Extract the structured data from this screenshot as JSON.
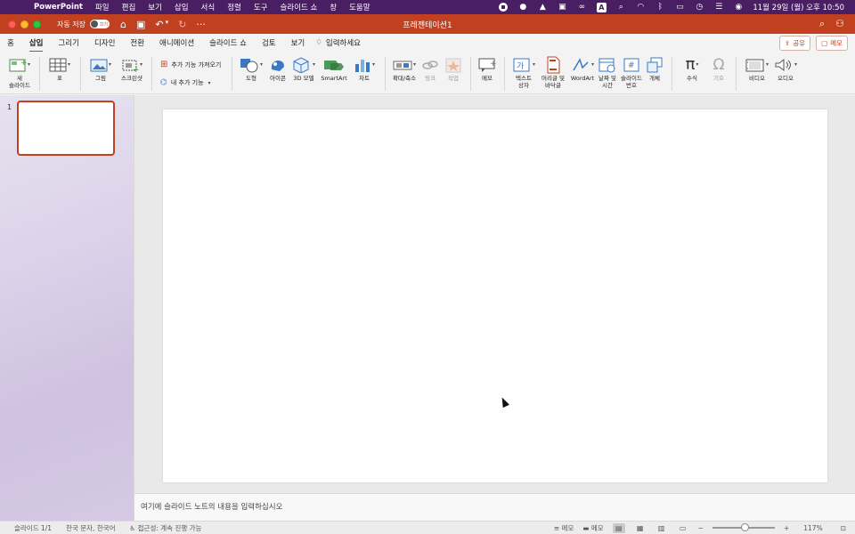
{
  "menubar": {
    "app": "PowerPoint",
    "items": [
      "파일",
      "편집",
      "보기",
      "삽입",
      "서식",
      "정렬",
      "도구",
      "슬라이드 쇼",
      "창",
      "도움말"
    ],
    "clock": "11월 29일 (월) 오후 10:50",
    "bg_color": "#4a1e63"
  },
  "titlebar": {
    "autosave_label": "자동 저장",
    "toggle_label": "끄기",
    "doc_title": "프레젠테이션1",
    "bg_color": "#c0401f"
  },
  "tabs": {
    "items": [
      "홈",
      "삽입",
      "그리기",
      "디자인",
      "전환",
      "애니메이션",
      "슬라이드 쇼",
      "검토",
      "보기"
    ],
    "active": "삽입",
    "tell_me": "입력하세요",
    "share": "공유",
    "comments": "메모"
  },
  "ribbon": {
    "new_slide": "새\n슬라이드",
    "table": "표",
    "pictures": "그림",
    "screenshot": "스크린샷",
    "get_addins": "추가 기능 가져오기",
    "my_addins": "내 추가 기능",
    "shapes": "도형",
    "icons": "아이콘",
    "models_3d": "3D 모델",
    "smartart": "SmartArt",
    "chart": "차트",
    "zoom": "확대/축소",
    "link": "링크",
    "action": "작업",
    "comment": "메모",
    "textbox": "텍스트\n상자",
    "header_footer": "머리글 및\n바닥글",
    "wordart": "WordArt",
    "date_time": "날짜 및\n시간",
    "slide_number": "슬라이드\n번호",
    "object": "개체",
    "equation": "수식",
    "symbol": "기호",
    "video": "비디오",
    "audio": "오디오"
  },
  "slides_pane": {
    "slide_number": "1"
  },
  "notes": {
    "placeholder": "여기에 슬라이드 노트의 내용을 입력하십시오"
  },
  "status": {
    "slide": "슬라이드 1/1",
    "language": "한국 문자, 한국어",
    "accessibility": "접근성: 계속 진행 가능",
    "notes_btn": "메모",
    "comments_btn": "메모",
    "zoom": "117%"
  }
}
